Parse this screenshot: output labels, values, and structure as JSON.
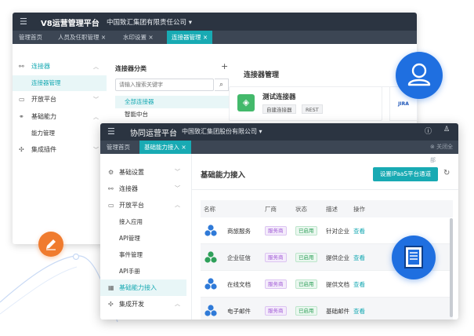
{
  "back_window": {
    "app_title": "V8运营管理平台",
    "org": "中国致汇集团有限责任公司 ▾",
    "tabs": [
      {
        "label": "管理首页"
      },
      {
        "label": "人员及任职管理 ×"
      },
      {
        "label": "水印设置 ×"
      },
      {
        "label": "连接器管理 ×"
      }
    ],
    "sidebar": {
      "items": [
        {
          "label": "连接器"
        },
        {
          "label": "连接器管理"
        },
        {
          "label": "开放平台"
        },
        {
          "label": "基础能力"
        },
        {
          "label": "能力管理"
        },
        {
          "label": "集成插件"
        }
      ]
    },
    "category": {
      "title": "连接器分类",
      "add": "+",
      "search_placeholder": "请输入搜索关键字",
      "nodes": [
        "全部连接器",
        "智能中台"
      ]
    },
    "main": {
      "title": "连接器管理",
      "card": {
        "name": "测试连接器",
        "tags": [
          "自建连接器",
          "REST"
        ]
      },
      "jira": "JIRA"
    }
  },
  "front_window": {
    "app_title": "协同运营平台",
    "org": "中国致汇集团股份有限公司 ▾",
    "tabs": [
      {
        "label": "管理首页"
      },
      {
        "label": "基础能力接入 ×"
      }
    ],
    "close_all": "⊗ 关闭全部",
    "sidebar": {
      "items": [
        {
          "label": "基础设置"
        },
        {
          "label": "连接器"
        },
        {
          "label": "开放平台"
        },
        {
          "label": "接入应用"
        },
        {
          "label": "API管理"
        },
        {
          "label": "事件管理"
        },
        {
          "label": "API手册"
        },
        {
          "label": "基础能力接入"
        },
        {
          "label": "集成开发"
        }
      ]
    },
    "content": {
      "title": "基础能力接入",
      "ipaas_button": "设置IPaaS平台通道",
      "table": {
        "headers": [
          "名称",
          "厂商",
          "状态",
          "描述",
          "操作"
        ],
        "rows": [
          {
            "name": "商旅服务",
            "vendor": "服务商",
            "status": "已启用",
            "desc": "针对企业",
            "op": "查看"
          },
          {
            "name": "企业征信",
            "vendor": "服务商",
            "status": "已启用",
            "desc": "提供企业",
            "op": "查看"
          },
          {
            "name": "在线文档",
            "vendor": "服务商",
            "status": "已启用",
            "desc": "提供文档",
            "op": "查看"
          },
          {
            "name": "电子邮件",
            "vendor": "服务商",
            "status": "已启用",
            "desc": "基础邮件",
            "op": "查看"
          }
        ]
      }
    }
  },
  "colors": {
    "accent": "#18aab3",
    "titlebar": "#2b3441",
    "tabbar": "#3c4654",
    "badge_blue": "#1f6fe0",
    "badge_orange": "#f07b2e",
    "vendor_purple": "#a05ad6",
    "status_green": "#2fa05a"
  }
}
